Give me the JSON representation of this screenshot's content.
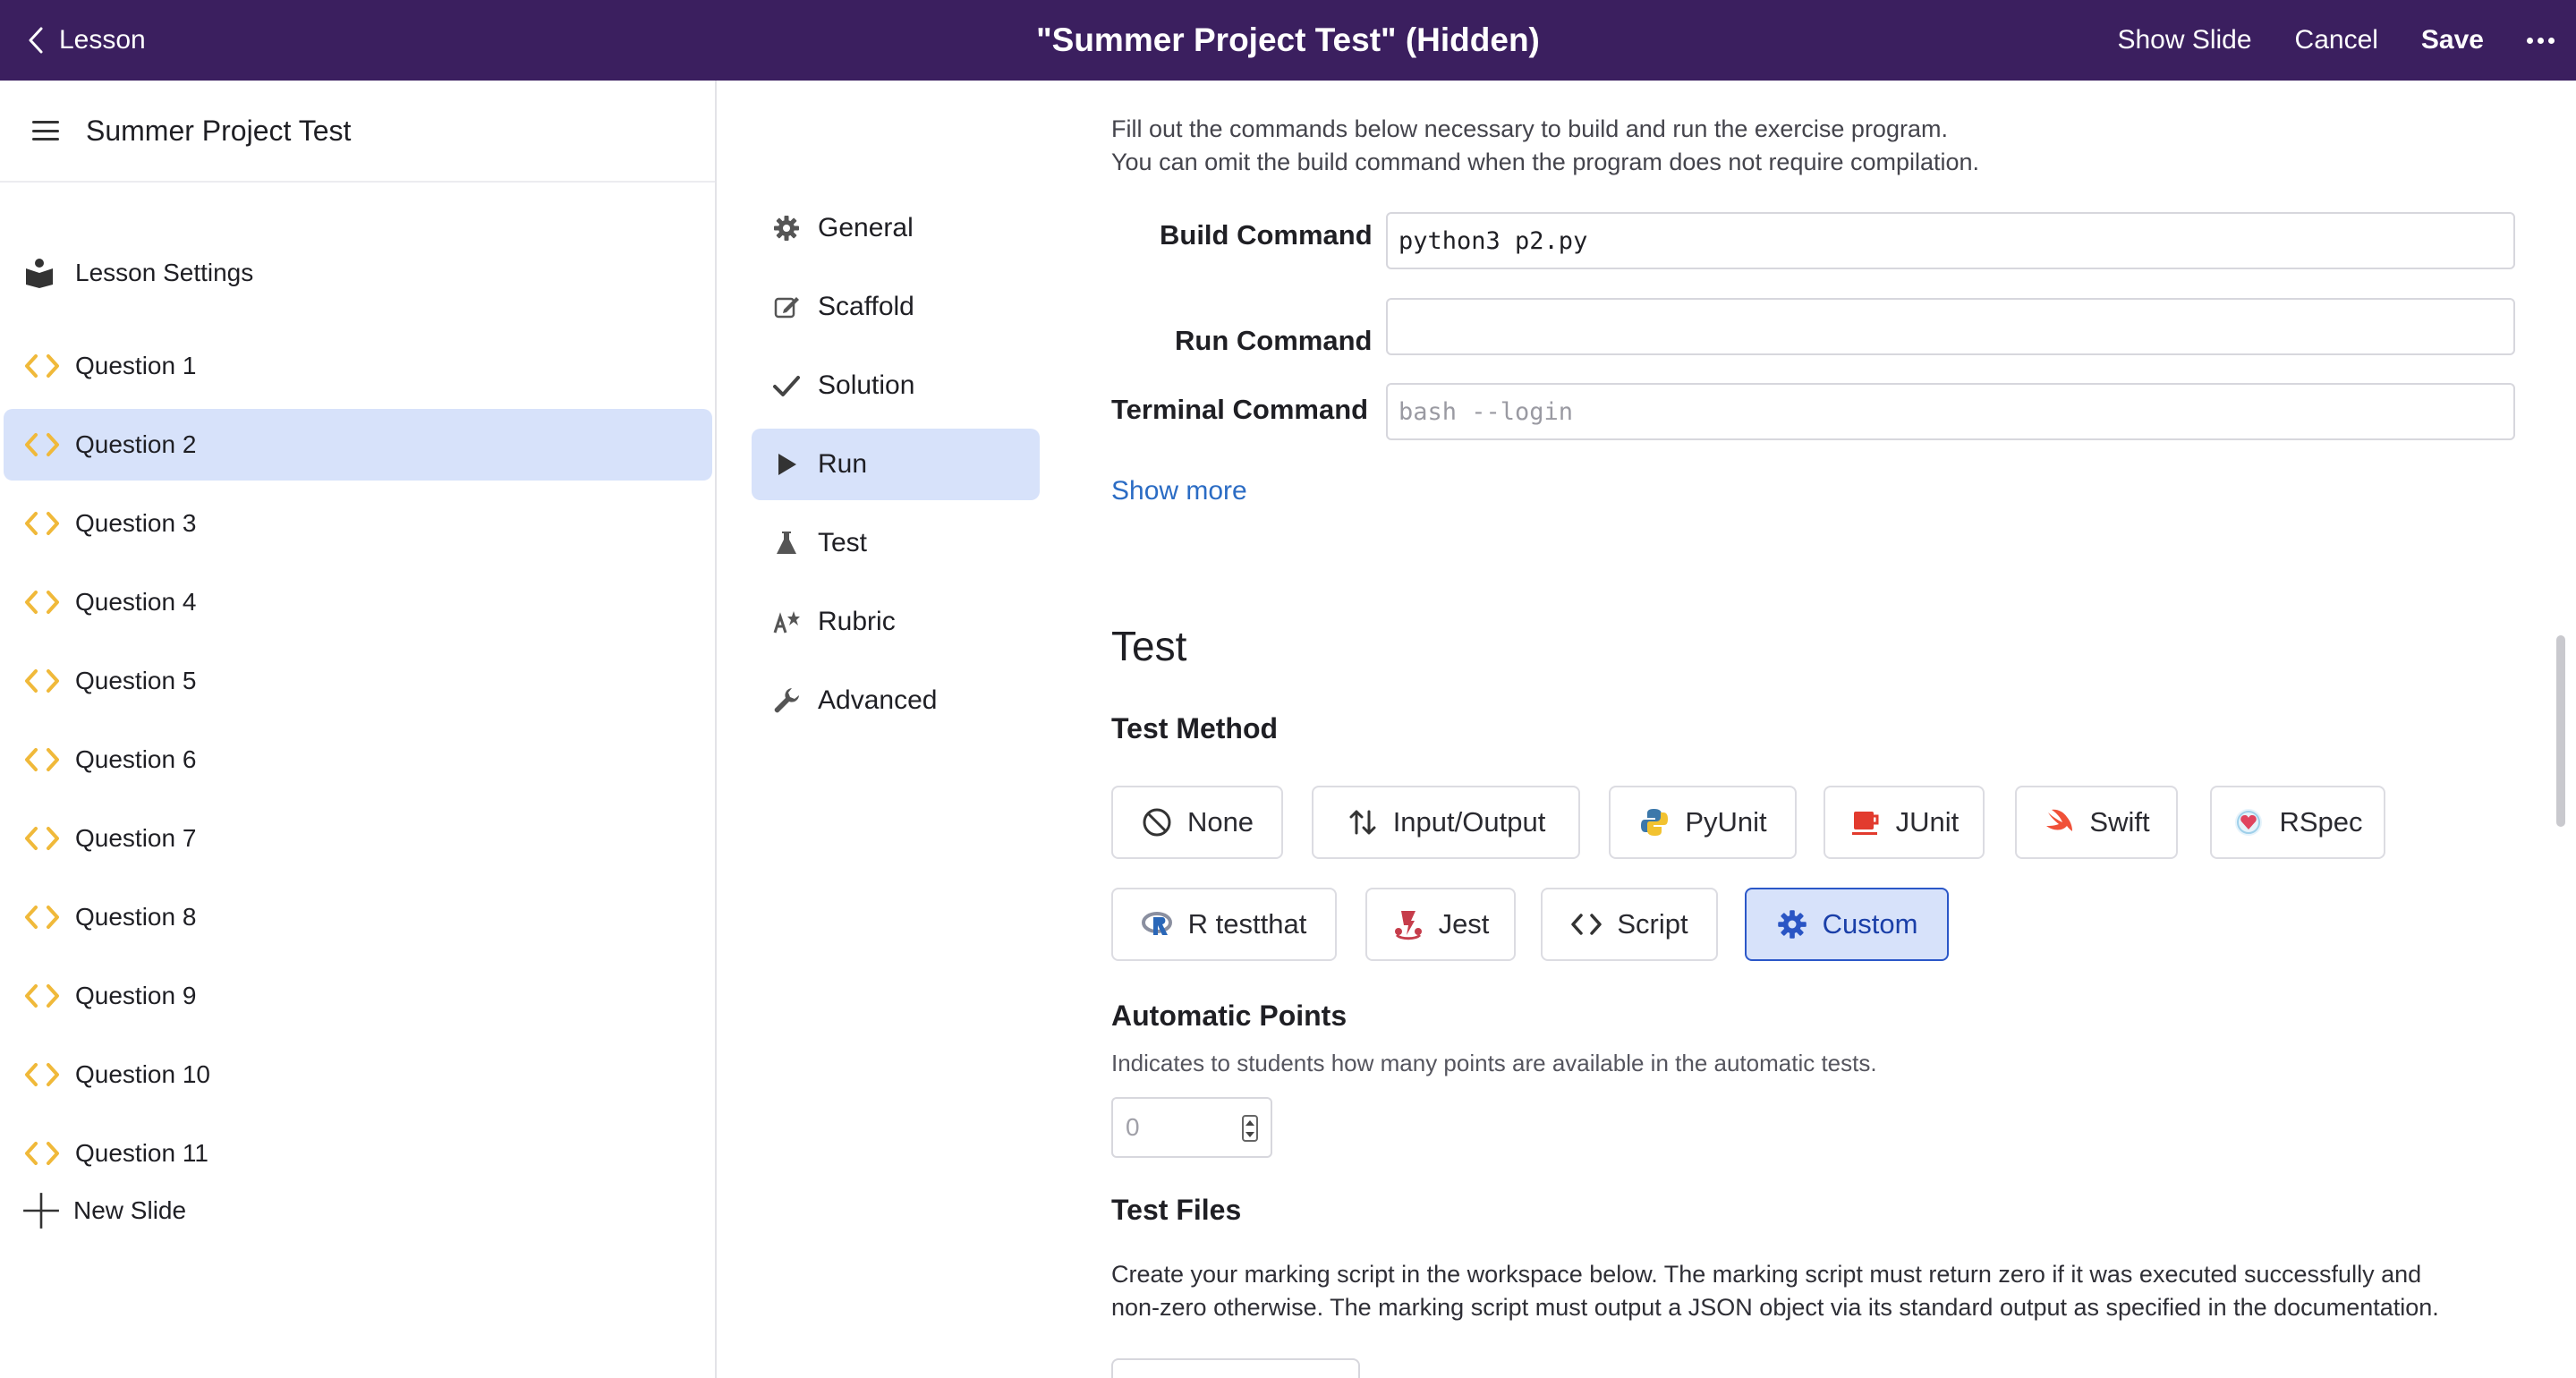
{
  "topbar": {
    "back_label": "Lesson",
    "title": "\"Summer Project Test\" (Hidden)",
    "show_slide": "Show Slide",
    "cancel": "Cancel",
    "save": "Save"
  },
  "sidebar": {
    "title": "Summer Project Test",
    "settings_label": "Lesson Settings",
    "items": [
      {
        "label": "Question 1"
      },
      {
        "label": "Question 2"
      },
      {
        "label": "Question 3"
      },
      {
        "label": "Question 4"
      },
      {
        "label": "Question 5"
      },
      {
        "label": "Question 6"
      },
      {
        "label": "Question 7"
      },
      {
        "label": "Question 8"
      },
      {
        "label": "Question 9"
      },
      {
        "label": "Question 10"
      },
      {
        "label": "Question 11"
      }
    ],
    "active_item": "Question 2",
    "new_slide": "New Slide"
  },
  "midnav": {
    "items": [
      {
        "label": "General",
        "icon": "gear-icon"
      },
      {
        "label": "Scaffold",
        "icon": "edit-icon"
      },
      {
        "label": "Solution",
        "icon": "check-icon"
      },
      {
        "label": "Run",
        "icon": "play-icon"
      },
      {
        "label": "Test",
        "icon": "flask-icon"
      },
      {
        "label": "Rubric",
        "icon": "rubric-icon"
      },
      {
        "label": "Advanced",
        "icon": "wrench-icon"
      }
    ],
    "active": "Run"
  },
  "run": {
    "description_line1": "Fill out the commands below necessary to build and run the exercise program.",
    "description_line2": "You can omit the build command when the program does not require compilation.",
    "build_label": "Build Command",
    "build_value": "python3 p2.py",
    "run_label": "Run Command",
    "run_value": "",
    "terminal_label": "Terminal Command",
    "terminal_placeholder": "bash --login",
    "show_more": "Show more"
  },
  "test": {
    "section_title": "Test",
    "method_label": "Test Method",
    "methods": [
      {
        "label": "None",
        "icon": "ban-icon"
      },
      {
        "label": "Input/Output",
        "icon": "arrows-updown-icon"
      },
      {
        "label": "PyUnit",
        "icon": "python-icon"
      },
      {
        "label": "JUnit",
        "icon": "java-cup-icon"
      },
      {
        "label": "Swift",
        "icon": "swift-icon"
      },
      {
        "label": "RSpec",
        "icon": "ruby-icon"
      },
      {
        "label": "R testthat",
        "icon": "r-icon"
      },
      {
        "label": "Jest",
        "icon": "jest-icon"
      },
      {
        "label": "Script",
        "icon": "code-icon"
      },
      {
        "label": "Custom",
        "icon": "gear-icon"
      }
    ],
    "selected_method": "Custom",
    "points_label": "Automatic Points",
    "points_help": "Indicates to students how many points are available in the automatic tests.",
    "points_placeholder": "0",
    "files_label": "Test Files",
    "files_desc_line1": "Create your marking script in the workspace below. The marking script must return zero if it was executed successfully and",
    "files_desc_line2": "non-zero otherwise. The marking script must output a JSON object via its standard output as specified in the documentation."
  },
  "colors": {
    "topbar": "#3b1f5f",
    "active_bg": "#d7e2fa",
    "link": "#2b6cc4",
    "code_icon": "#f0b93a",
    "selected_border": "#2b57c8"
  }
}
